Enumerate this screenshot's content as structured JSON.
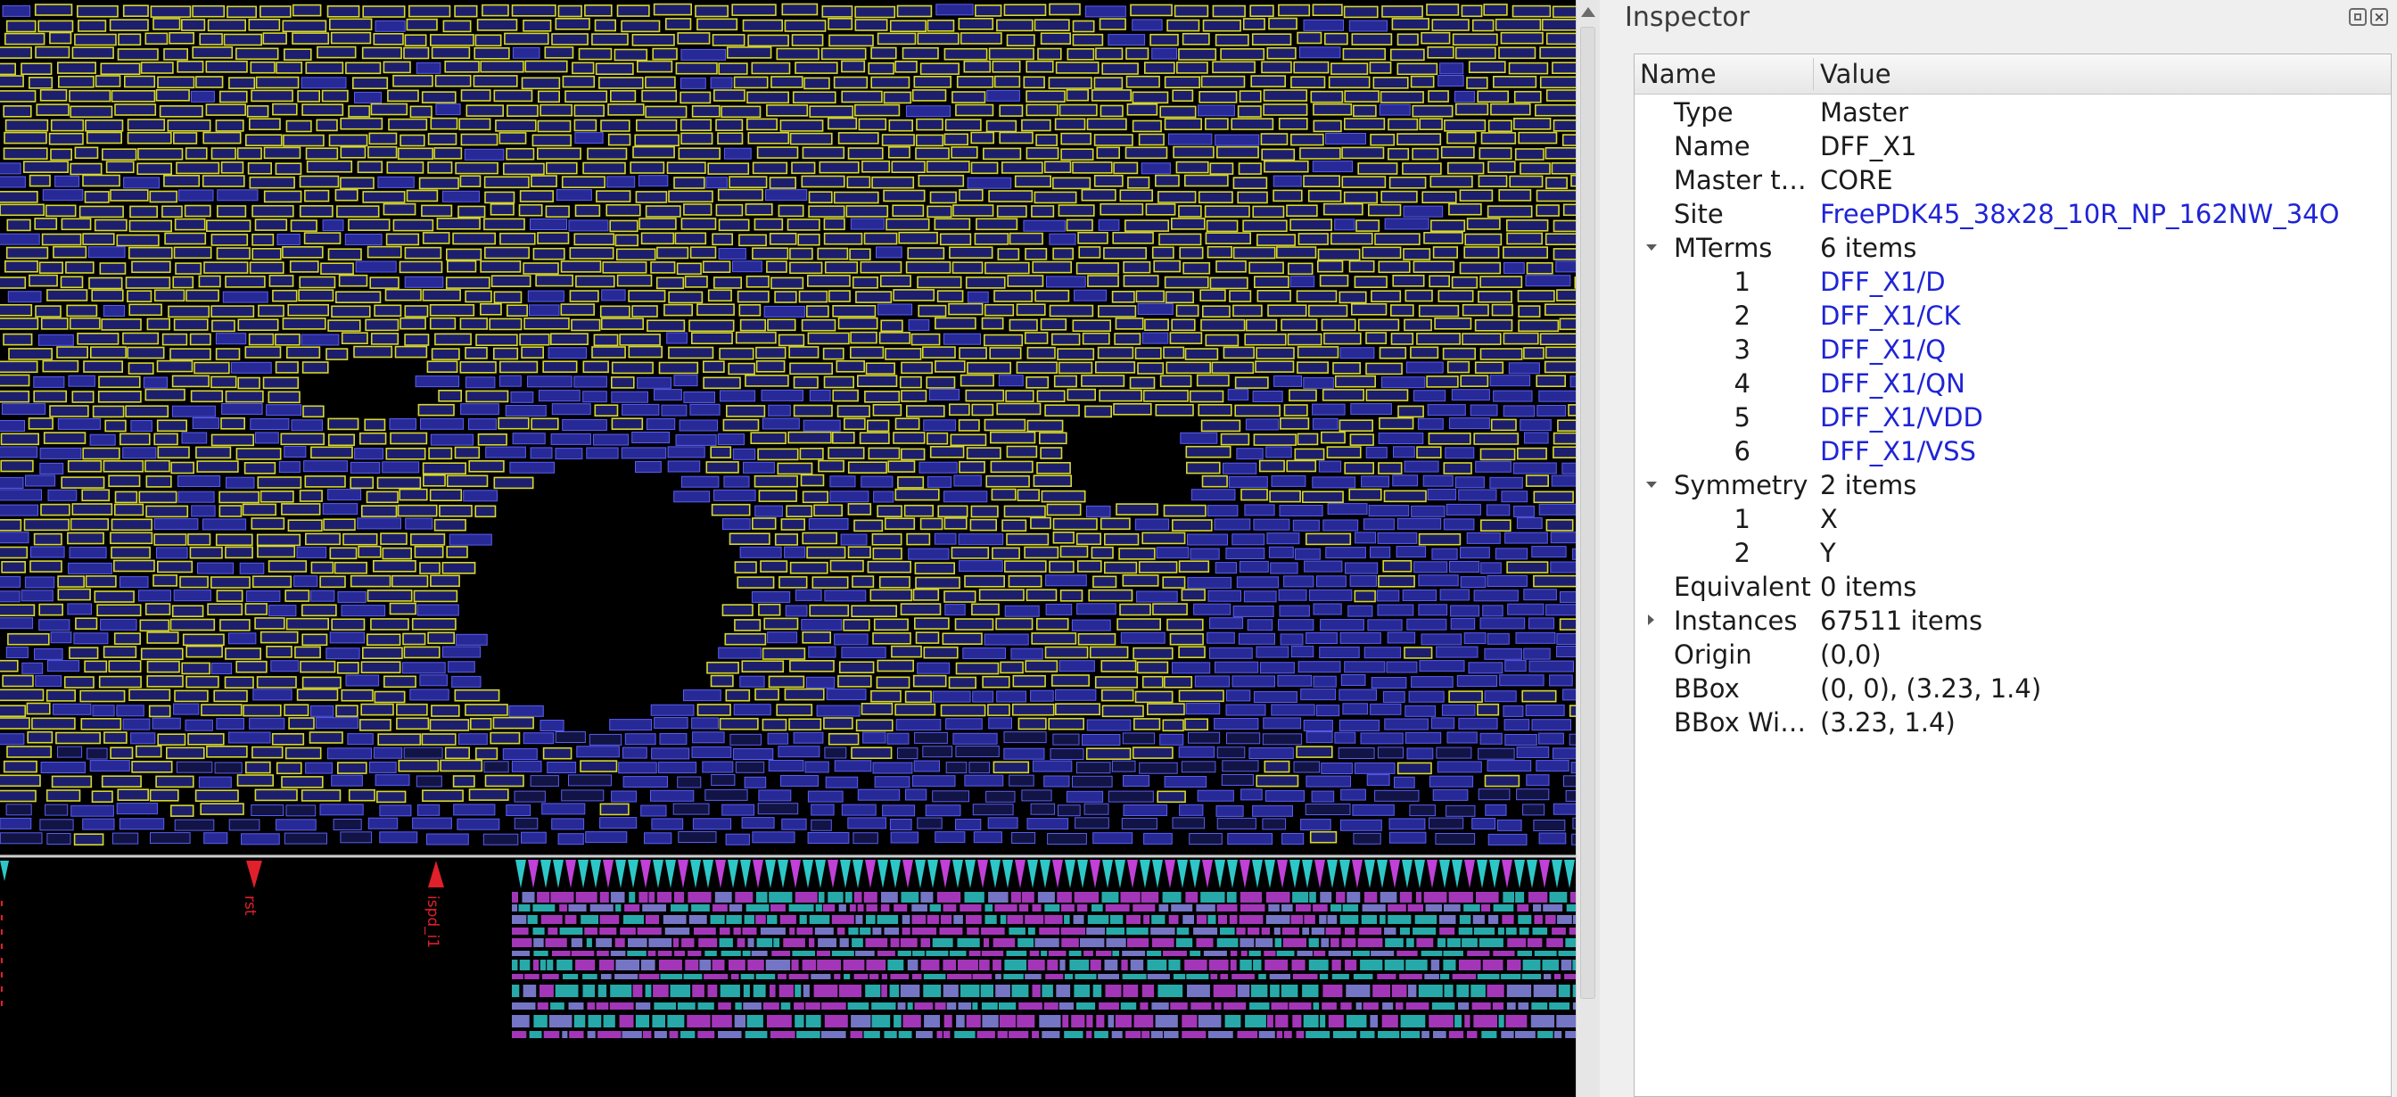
{
  "inspector": {
    "title": "Inspector",
    "columns": {
      "name": "Name",
      "value": "Value"
    },
    "rows": [
      {
        "name": "Type",
        "value": "Master",
        "kind": "prop"
      },
      {
        "name": "Name",
        "value": "DFF_X1",
        "kind": "prop"
      },
      {
        "name": "Master t…",
        "value": "CORE",
        "kind": "prop"
      },
      {
        "name": "Site",
        "value": "FreePDK45_38x28_10R_NP_162NW_34O",
        "kind": "prop",
        "link": true
      },
      {
        "name": "MTerms",
        "value": "6 items",
        "kind": "group",
        "expanded": true
      },
      {
        "name": "1",
        "value": "DFF_X1/D",
        "kind": "child",
        "link": true
      },
      {
        "name": "2",
        "value": "DFF_X1/CK",
        "kind": "child",
        "link": true
      },
      {
        "name": "3",
        "value": "DFF_X1/Q",
        "kind": "child",
        "link": true
      },
      {
        "name": "4",
        "value": "DFF_X1/QN",
        "kind": "child",
        "link": true
      },
      {
        "name": "5",
        "value": "DFF_X1/VDD",
        "kind": "child",
        "link": true
      },
      {
        "name": "6",
        "value": "DFF_X1/VSS",
        "kind": "child",
        "link": true
      },
      {
        "name": "Symmetry",
        "value": "2 items",
        "kind": "group",
        "expanded": true
      },
      {
        "name": "1",
        "value": "X",
        "kind": "child"
      },
      {
        "name": "2",
        "value": "Y",
        "kind": "child"
      },
      {
        "name": "Equivalent",
        "value": "0 items",
        "kind": "prop"
      },
      {
        "name": "Instances",
        "value": "67511 items",
        "kind": "group",
        "expanded": false
      },
      {
        "name": "Origin",
        "value": "(0,0)",
        "kind": "prop"
      },
      {
        "name": "BBox",
        "value": "(0, 0), (3.23, 1.4)",
        "kind": "prop"
      },
      {
        "name": "BBox Wi…",
        "value": "(3.23, 1.4)",
        "kind": "prop"
      }
    ]
  },
  "layout": {
    "pin_labels": [
      "rst",
      "ispd_i1"
    ],
    "colors": {
      "background": "#000000",
      "cell_outline": "#d8d82a",
      "cell_fill": "#3438c8",
      "pin_marker": "#e0202a",
      "io_row_cyan": "#2ec7c7",
      "io_row_magenta": "#c040d8",
      "row_separator": "#cfcfcf"
    }
  },
  "icons": [
    "float-icon",
    "close-icon",
    "scroll-up-arrow"
  ]
}
